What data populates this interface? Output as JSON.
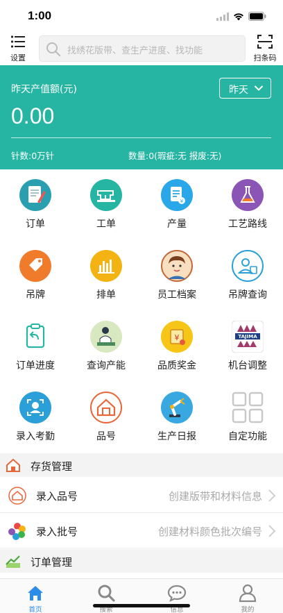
{
  "status_bar": {
    "time": "1:00"
  },
  "header": {
    "menu_label": "设置",
    "search_placeholder": "找绣花版带、查生产进度、找功能",
    "scan_label": "扫条码"
  },
  "summary": {
    "title": "昨天产值额(元)",
    "value": "0.00",
    "period": "昨天",
    "stitches": "针数:0万针",
    "quantity": "数量:0(瑕疵:无 报废:无)"
  },
  "grid": [
    {
      "label": "订单",
      "icon": "order-icon",
      "color": "#2a9fb0"
    },
    {
      "label": "工单",
      "icon": "sewing-machine-icon",
      "color": "#26b5a2"
    },
    {
      "label": "产量",
      "icon": "output-icon",
      "color": "#2aa7e8"
    },
    {
      "label": "工艺路线",
      "icon": "flask-icon",
      "color": "#8a55b5"
    },
    {
      "label": "吊牌",
      "icon": "tag-icon",
      "color": "#f07b2a"
    },
    {
      "label": "排单",
      "icon": "schedule-icon",
      "color": "#f3b313"
    },
    {
      "label": "员工档案",
      "icon": "employee-icon",
      "color": "#f3d7a8"
    },
    {
      "label": "吊牌查询",
      "icon": "tag-search-icon",
      "color": "#2a9fd8"
    },
    {
      "label": "订单进度",
      "icon": "order-progress-icon",
      "color": "#26b5a2"
    },
    {
      "label": "查询产能",
      "icon": "capacity-icon",
      "color": "#cfe2b5"
    },
    {
      "label": "品质奖金",
      "icon": "bonus-icon",
      "color": "#f6c517"
    },
    {
      "label": "机台调整",
      "icon": "tajima-icon",
      "color": "#ffffff"
    },
    {
      "label": "录入考勤",
      "icon": "attendance-icon",
      "color": "#2a9fd8"
    },
    {
      "label": "品号",
      "icon": "product-icon",
      "color": "#e8673a"
    },
    {
      "label": "生产日报",
      "icon": "robot-arm-icon",
      "color": "#3aa8e0"
    },
    {
      "label": "自定功能",
      "icon": "custom-grid-icon",
      "color": "#c8c8c8"
    }
  ],
  "tajima_text": "TAJIMA",
  "inventory": {
    "title": "存货管理",
    "rows": [
      {
        "label": "录入品号",
        "desc": "创建版带和材料信息"
      },
      {
        "label": "录入批号",
        "desc": "创建材料颜色批次编号"
      }
    ]
  },
  "orders": {
    "title": "订单管理"
  },
  "tabs": [
    {
      "label": "首页",
      "icon": "home-icon",
      "active": true
    },
    {
      "label": "搜索",
      "icon": "search-icon",
      "active": false
    },
    {
      "label": "信息",
      "icon": "message-icon",
      "active": false
    },
    {
      "label": "我的",
      "icon": "profile-icon",
      "active": false
    }
  ]
}
